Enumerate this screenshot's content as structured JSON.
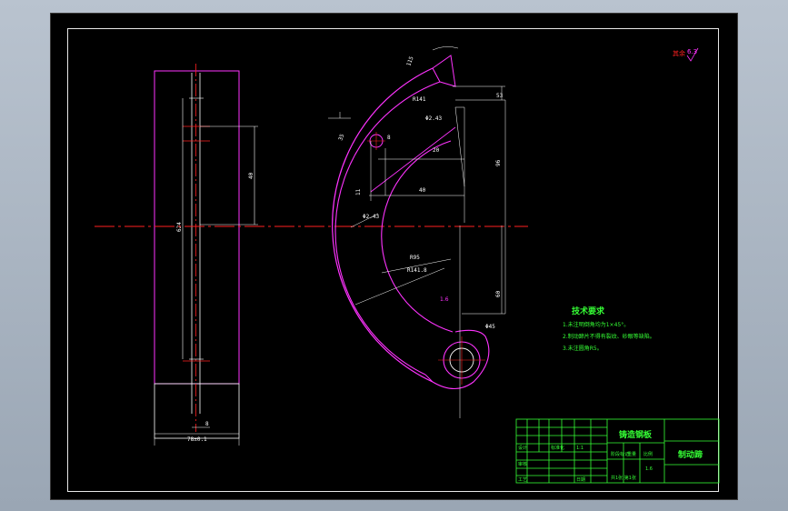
{
  "colors": {
    "background": "#000000",
    "part": "#ff33ff",
    "dimension": "#ffffff",
    "centerline": "#ff2020",
    "notes": "#35ff35"
  },
  "dimensions": {
    "d_115": "115",
    "d_r141": "R141",
    "d_phi2_top": "Φ2.43",
    "d_phi2_mid": "Φ2.43",
    "d_r95": "R95",
    "d_r141_8": "R141.8",
    "d_phi45": "Φ45",
    "d_8": "8",
    "d_35": "35",
    "d_11": "11",
    "d_20": "20",
    "d_40": "40",
    "d_96": "96",
    "d_60": "60",
    "d_53": "53",
    "d_78": "78±0.1",
    "d_fig": "8",
    "d_624": "624",
    "d_h1": "40"
  },
  "surface_mark": {
    "label": "其余",
    "value": "6.3"
  },
  "roughness_note": "1.6",
  "tech_requirements": {
    "title": "技术要求",
    "items": [
      "1.未注明倒角均为1×45°。",
      "2.制动蹄片不得有裂纹、砂眼等缺陷。",
      "3.未注圆角R5。"
    ]
  },
  "title_block": {
    "part_name": "铸造钢板",
    "drawing_name": "制动蹄",
    "scale": "1:1",
    "sheet": "共1张 第1张",
    "designed": "设计",
    "approved": "审核",
    "process": "工艺",
    "standard": "标准化",
    "mass": "重量",
    "ratio": "比例",
    "stage_mark": "阶段标记",
    "date": "日期",
    "rev": "1.6"
  }
}
